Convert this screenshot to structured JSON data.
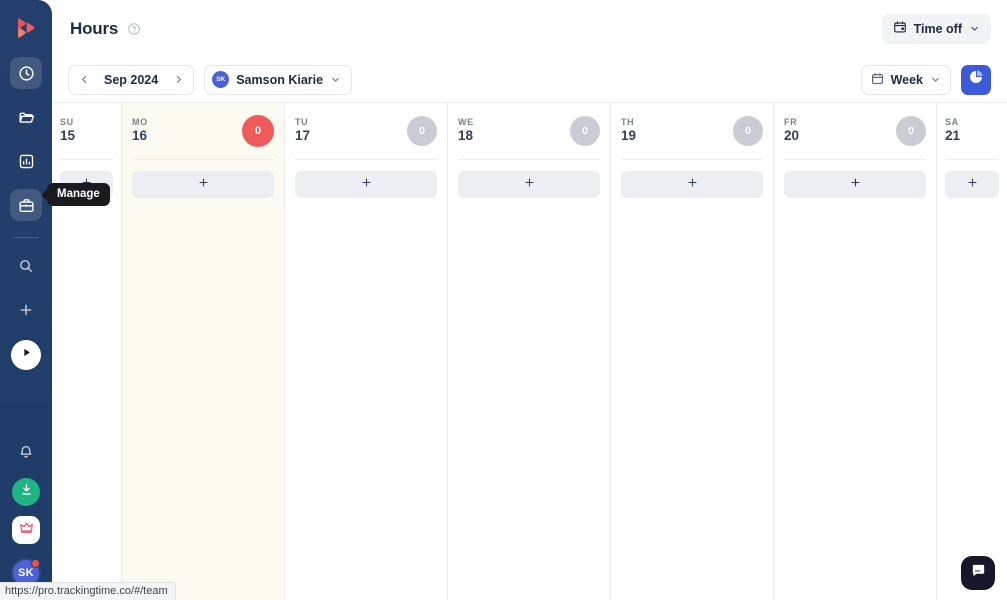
{
  "app": {
    "logo_icon": "trackingtime-logo-icon",
    "status_url": "https://pro.trackingtime.co/#/team"
  },
  "sidebar": {
    "items": [
      {
        "name": "hours",
        "icon": "clock-icon",
        "active": true
      },
      {
        "name": "projects",
        "icon": "folder-icon",
        "active": false
      },
      {
        "name": "reports",
        "icon": "report-chart-icon",
        "active": false
      },
      {
        "name": "manage",
        "icon": "briefcase-icon",
        "active": true
      }
    ],
    "search_icon": "search-icon",
    "add_icon": "plus-icon",
    "play_icon": "play-icon",
    "bell_icon": "bell-icon",
    "download_icon": "download-icon",
    "premium_icon": "crown-icon",
    "avatar_initials": "SK",
    "tooltip": "Manage"
  },
  "header": {
    "title": "Hours",
    "help_icon": "question-circle-icon",
    "time_off_label": "Time off",
    "time_off_icon": "calendar-lock-icon",
    "time_off_chevron": "chevron-down-icon"
  },
  "toolbar": {
    "prev_icon": "chevron-left-icon",
    "next_icon": "chevron-right-icon",
    "period_label": "Sep 2024",
    "user_name": "Samson Kiarie",
    "user_initials": "SK",
    "user_chevron": "chevron-down-icon",
    "view_label": "Week",
    "view_icon": "calendar-icon",
    "view_chevron": "chevron-down-icon",
    "chart_button_icon": "pie-chart-icon"
  },
  "calendar": {
    "days": [
      {
        "dow": "SU",
        "num": "15",
        "weekend": true,
        "today": false,
        "hours": null,
        "add_icon": "plus-icon"
      },
      {
        "dow": "MO",
        "num": "16",
        "weekend": false,
        "today": true,
        "hours": "0",
        "alert": true,
        "add_icon": "plus-icon"
      },
      {
        "dow": "TU",
        "num": "17",
        "weekend": false,
        "today": false,
        "hours": "0",
        "alert": false,
        "add_icon": "plus-icon"
      },
      {
        "dow": "WE",
        "num": "18",
        "weekend": false,
        "today": false,
        "hours": "0",
        "alert": false,
        "add_icon": "plus-icon"
      },
      {
        "dow": "TH",
        "num": "19",
        "weekend": false,
        "today": false,
        "hours": "0",
        "alert": false,
        "add_icon": "plus-icon"
      },
      {
        "dow": "FR",
        "num": "20",
        "weekend": false,
        "today": false,
        "hours": "0",
        "alert": false,
        "add_icon": "plus-icon"
      },
      {
        "dow": "SA",
        "num": "21",
        "weekend": true,
        "today": false,
        "hours": null,
        "add_icon": "plus-icon"
      }
    ]
  },
  "chat": {
    "icon": "chat-bubble-icon"
  },
  "colors": {
    "sidebar": "#22406e",
    "accent_blue": "#3b5bdb",
    "alert_red": "#f05a5a",
    "badge_grey": "#c9cdd3",
    "today_bg": "#fbfbf1",
    "green": "#1fb582"
  }
}
